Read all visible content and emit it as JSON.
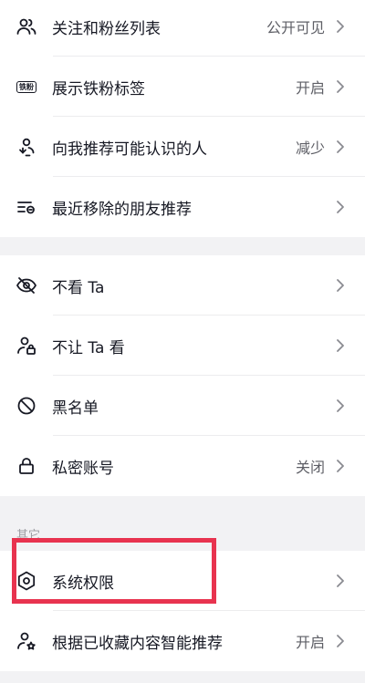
{
  "group1": {
    "items": [
      {
        "label": "关注和粉丝列表",
        "value": "公开可见",
        "icon": "people-icon"
      },
      {
        "label": "展示铁粉标签",
        "value": "开启",
        "icon": "fan-badge-icon",
        "badge_text": "铁粉"
      },
      {
        "label": "向我推荐可能认识的人",
        "value": "减少",
        "icon": "recommend-person-icon"
      },
      {
        "label": "最近移除的朋友推荐",
        "value": "",
        "icon": "removed-list-icon"
      }
    ]
  },
  "group2": {
    "items": [
      {
        "label": "不看 Ta",
        "value": "",
        "icon": "eye-off-icon"
      },
      {
        "label": "不让 Ta 看",
        "value": "",
        "icon": "person-lock-icon"
      },
      {
        "label": "黑名单",
        "value": "",
        "icon": "block-icon"
      },
      {
        "label": "私密账号",
        "value": "关闭",
        "icon": "lock-icon"
      }
    ]
  },
  "group3": {
    "header": "其它",
    "items": [
      {
        "label": "系统权限",
        "value": "",
        "icon": "hexagon-settings-icon"
      },
      {
        "label": "根据已收藏内容智能推荐",
        "value": "开启",
        "icon": "person-star-icon"
      }
    ]
  },
  "colors": {
    "highlight": "#e8334f",
    "text": "#161823",
    "secondary": "#5e5f66",
    "background": "#f2f2f4"
  }
}
